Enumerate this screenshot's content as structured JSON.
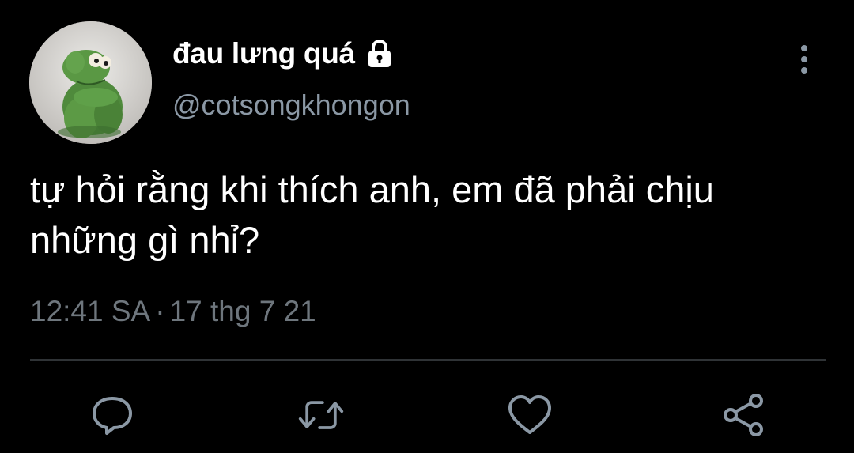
{
  "tweet": {
    "display_name": "đau lưng quá",
    "handle": "@cotsongkhongon",
    "text": "tự hỏi rằng khi thích anh, em đã phải chịu những gì nhỉ?",
    "time": "12:41 SA",
    "separator": "·",
    "date": "17 thg 7 21",
    "protected_icon": "lock-icon",
    "avatar_subject": "green frog plush"
  },
  "actions": [
    {
      "name": "reply",
      "icon": "comment-icon"
    },
    {
      "name": "retweet",
      "icon": "retweet-icon"
    },
    {
      "name": "like",
      "icon": "heart-icon"
    },
    {
      "name": "share",
      "icon": "share-icon"
    }
  ],
  "colors": {
    "background": "#000000",
    "text": "#ffffff",
    "handle": "#8b98a5",
    "meta": "#6e767d",
    "icon": "#8b98a5",
    "divider": "#2f3336"
  }
}
